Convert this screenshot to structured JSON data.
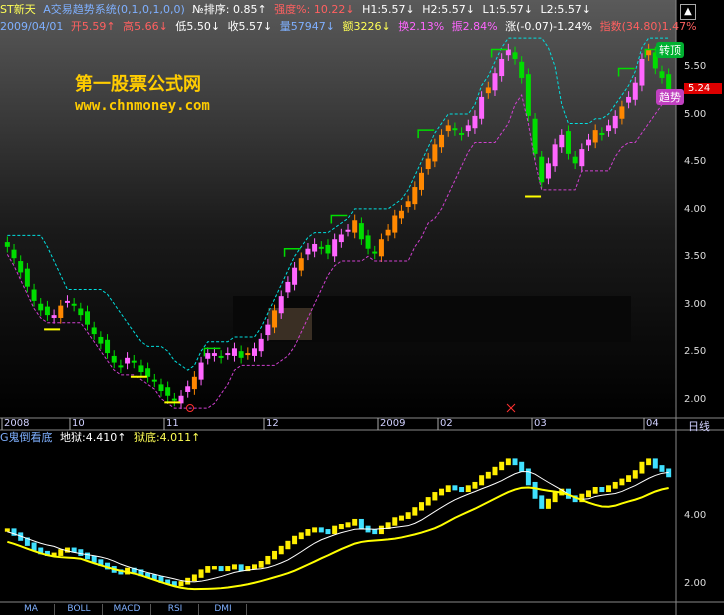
{
  "header1": {
    "stock_name": "ST新天",
    "indicator": "A交易趋势系统(0,1,0,1,0,0)",
    "rank_label": "№排序:",
    "rank_value": "0.85↑",
    "strength_label": "强度%:",
    "strength_value": "10.22↓",
    "h1": "H1:5.57↓",
    "h2": "H2:5.57↓",
    "l1": "L1:5.57↓",
    "l2": "L2:5.57↓"
  },
  "header2": {
    "date": "2009/04/01",
    "open": "开5.59↑",
    "high": "高5.66↓",
    "low": "低5.50↓",
    "close": "收5.57↓",
    "volume": "量57947↓",
    "amount": "额3226↓",
    "turnover": "换2.13%",
    "amplitude": "振2.84%",
    "change": "涨(-0.07)-1.24%",
    "index": "指数(34.80)1.47%"
  },
  "watermark": {
    "line1": "第一股票公式网",
    "line2": "www.chnmoney.com"
  },
  "labels": {
    "top_pill": "转顶",
    "trend_pill": "趋势",
    "price_tag": "5.24",
    "period": "日线"
  },
  "price_axis": [
    "5.50",
    "5.00",
    "4.50",
    "4.00",
    "3.50",
    "3.00",
    "2.50",
    "2.00"
  ],
  "date_axis": [
    "2008",
    "10",
    "11",
    "12",
    "2009",
    "02",
    "03",
    "04"
  ],
  "lower_header": {
    "name": "G鬼倒看底",
    "hell": "地狱:4.410↑",
    "prison": "狱底:4.011↑"
  },
  "lower_axis": [
    "4.00",
    "2.00"
  ],
  "tabs": [
    "MA",
    "BOLL",
    "MACD",
    "RSI",
    "DMI"
  ],
  "colors": {
    "up": "#ff66ff",
    "down": "#00dd00",
    "orange": "#ff8800",
    "cyan_line": "#00e0e0",
    "magenta_line": "#d040d0",
    "yellow": "#ffff00"
  },
  "chart_data": {
    "type": "candlestick",
    "ylim": [
      1.9,
      5.8
    ],
    "close": [
      3.62,
      3.5,
      3.35,
      3.2,
      3.05,
      2.95,
      2.9,
      2.9,
      3.0,
      3.05,
      3.0,
      2.9,
      2.8,
      2.7,
      2.6,
      2.5,
      2.4,
      2.35,
      2.45,
      2.4,
      2.3,
      2.25,
      2.2,
      2.1,
      2.05,
      2.0,
      2.05,
      2.15,
      2.25,
      2.4,
      2.5,
      2.5,
      2.45,
      2.5,
      2.55,
      2.45,
      2.5,
      2.55,
      2.65,
      2.8,
      2.95,
      3.1,
      3.25,
      3.4,
      3.5,
      3.6,
      3.65,
      3.6,
      3.55,
      3.7,
      3.75,
      3.8,
      3.9,
      3.7,
      3.6,
      3.55,
      3.7,
      3.8,
      3.95,
      4.0,
      4.1,
      4.25,
      4.4,
      4.55,
      4.7,
      4.8,
      4.9,
      4.85,
      4.8,
      4.9,
      5.0,
      5.2,
      5.3,
      5.45,
      5.6,
      5.7,
      5.6,
      5.4,
      5.0,
      4.6,
      4.3,
      4.5,
      4.7,
      4.8,
      4.6,
      4.5,
      4.65,
      4.75,
      4.85,
      4.8,
      4.9,
      5.0,
      5.1,
      5.2,
      5.35,
      5.6,
      5.7,
      5.5,
      5.4,
      5.24
    ]
  }
}
